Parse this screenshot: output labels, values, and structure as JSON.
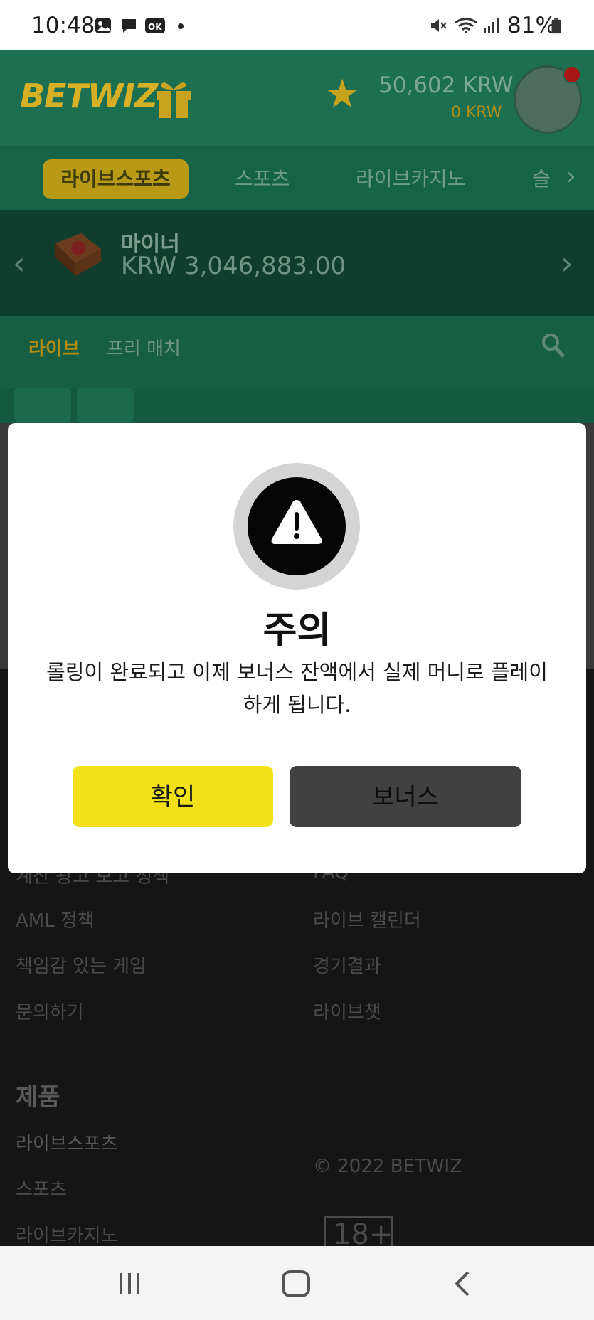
{
  "status_bar": {
    "time": "10:48",
    "battery_percent": "81%",
    "left_icons": [
      "image-icon",
      "message-icon",
      "ok-app-icon",
      "dot-icon"
    ],
    "right_icons": [
      "mute-icon",
      "wifi-icon",
      "signal-icon",
      "battery-icon"
    ]
  },
  "header": {
    "logo_text": "BETWIZ",
    "balance_main": "50,602 KRW",
    "balance_bonus": "0 KRW"
  },
  "nav_tabs": [
    {
      "label": "라이브스포츠",
      "active": true
    },
    {
      "label": "스포츠"
    },
    {
      "label": "라이브카지노"
    },
    {
      "label": "슬"
    }
  ],
  "jackpot": {
    "title": "마이너",
    "amount": "KRW 3,046,883.00"
  },
  "sub_tabs": {
    "live": "라이브",
    "prematch": "프리 매치"
  },
  "footer": {
    "left_links": [
      "계산 광고 보고 정책",
      "AML 정책",
      "책임감 있는 게임",
      "문의하기"
    ],
    "right_links": [
      "FAQ",
      "라이브 캘린더",
      "경기결과",
      "라이브챗"
    ],
    "products_heading": "제품",
    "product_links": [
      "라이브스포츠",
      "스포츠",
      "라이브카지노"
    ],
    "copyright": "© 2022 BETWIZ",
    "age_badge": "18+"
  },
  "modal": {
    "title": "주의",
    "message": "롤링이 완료되고 이제 보너스 잔액에서 실제 머니로 플레이하게 됩니다.",
    "confirm_label": "확인",
    "bonus_label": "보너스"
  },
  "colors": {
    "header_green": "#1c6f50",
    "accent_yellow": "#f2e119",
    "bonus_button": "#414141"
  }
}
